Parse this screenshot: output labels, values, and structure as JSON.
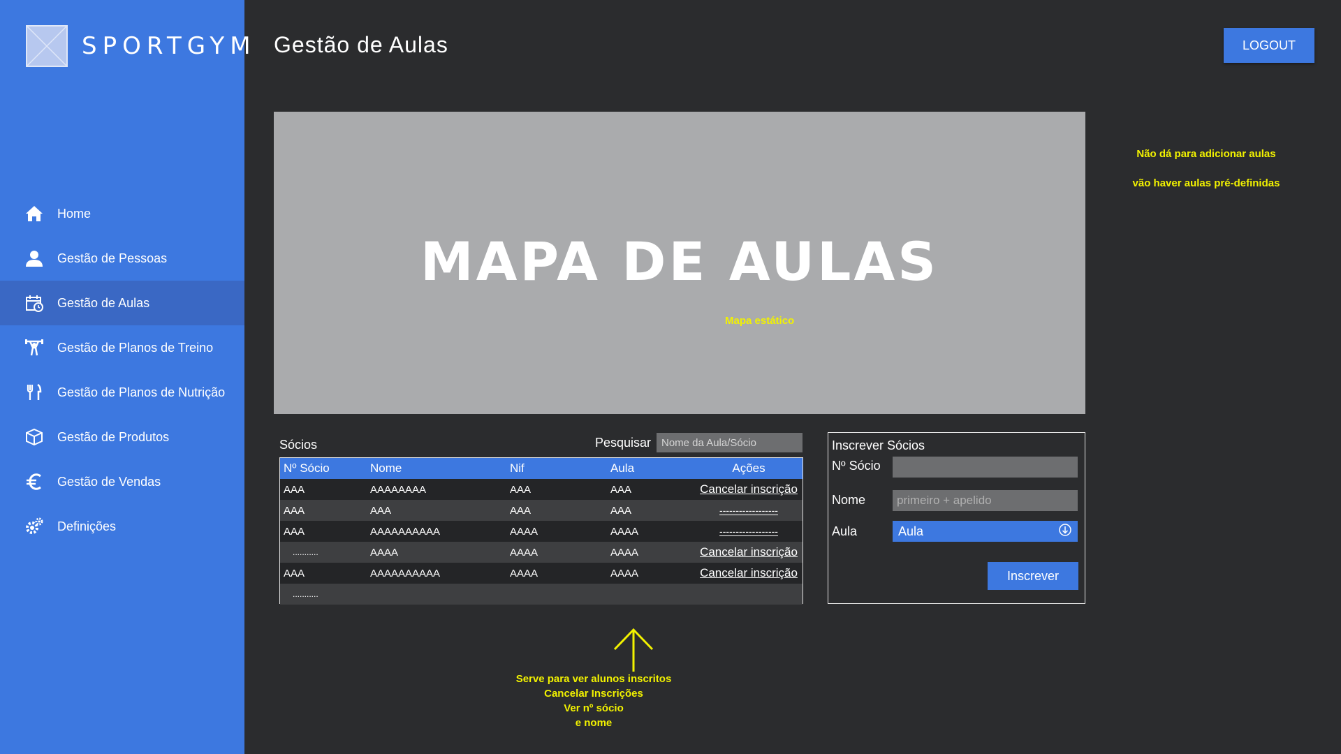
{
  "brand": {
    "name": "SPORTGYM"
  },
  "header": {
    "title": "Gestão de Aulas",
    "logout_label": "LOGOUT"
  },
  "sidebar": {
    "items": [
      {
        "label": "Home",
        "icon": "home-icon"
      },
      {
        "label": "Gestão de Pessoas",
        "icon": "user-icon"
      },
      {
        "label": "Gestão de Aulas",
        "icon": "calendar-icon",
        "active": true
      },
      {
        "label": "Gestão de Planos de Treino",
        "icon": "weightlifter-icon"
      },
      {
        "label": "Gestão de Planos de Nutrição",
        "icon": "fork-knife-icon"
      },
      {
        "label": "Gestão de Produtos",
        "icon": "box-icon"
      },
      {
        "label": "Gestão de Vendas",
        "icon": "euro-icon"
      },
      {
        "label": "Definições",
        "icon": "gears-icon"
      }
    ]
  },
  "map": {
    "title": "MAPA DE AULAS",
    "note": "Mapa estático"
  },
  "notes": {
    "right_line1": "Não dá para adicionar aulas",
    "right_line2": "vão haver aulas pré-definidas",
    "bottom": [
      "Serve para ver alunos inscritos",
      "Cancelar Inscrições",
      "Ver nº sócio",
      "e nome"
    ]
  },
  "socios": {
    "label": "Sócios",
    "search_label": "Pesquisar",
    "search_placeholder": "Nome da Aula/Sócio",
    "columns": [
      "Nº Sócio",
      "Nome",
      "Nif",
      "Aula",
      "Ações"
    ],
    "rows": [
      [
        "AAA",
        "AAAAAAAA",
        "AAA",
        "AAA",
        "Cancelar inscrição"
      ],
      [
        "AAA",
        "AAA",
        "AAA",
        "AAA",
        "------------------"
      ],
      [
        "AAA",
        "AAAAAAAAAA",
        "AAAA",
        "AAAA",
        "------------------"
      ],
      [
        "...........",
        "AAAA",
        "AAAA",
        "AAAA",
        "Cancelar inscrição"
      ],
      [
        "AAA",
        "AAAAAAAAAA",
        "AAAA",
        "AAAA",
        "Cancelar inscrição"
      ]
    ],
    "more": "..........."
  },
  "inscrever": {
    "title": "Inscrever Sócios",
    "socio_label": "Nº Sócio",
    "socio_value": "",
    "nome_label": "Nome",
    "nome_placeholder": "primeiro + apelido",
    "aula_label": "Aula",
    "aula_value": "Aula",
    "button_label": "Inscrever"
  },
  "colors": {
    "accent": "#3d78e0",
    "background": "#2b2c2e",
    "annotation": "#f2f200",
    "map": "#aaabad"
  }
}
